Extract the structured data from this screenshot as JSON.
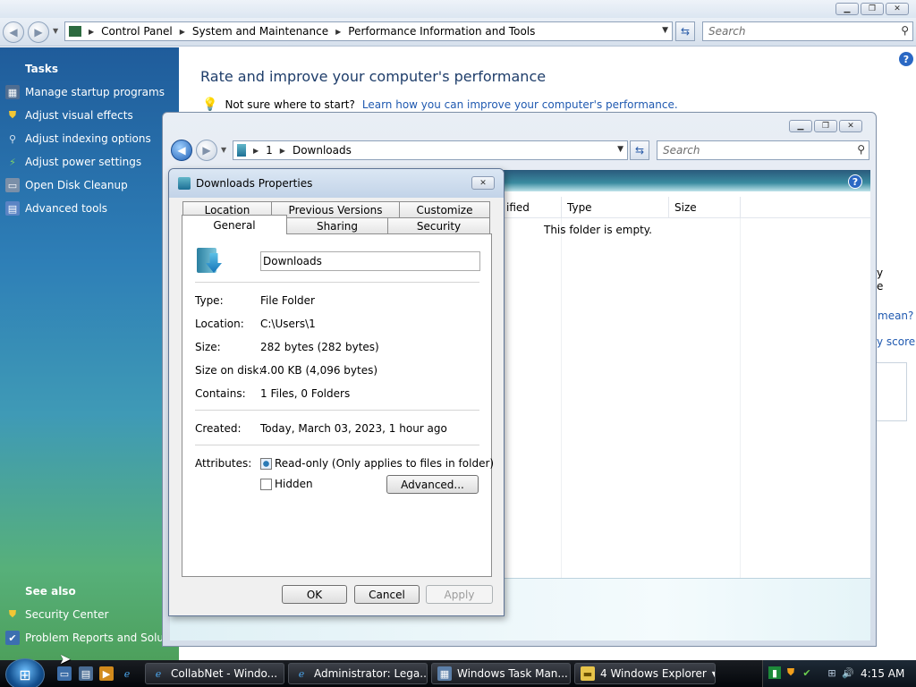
{
  "control_panel": {
    "breadcrumb": [
      "Control Panel",
      "System and Maintenance",
      "Performance Information and Tools"
    ],
    "search_placeholder": "Search",
    "sidebar": {
      "tasks_heading": "Tasks",
      "tasks": [
        {
          "label": "Manage startup programs",
          "icon": "startup-icon"
        },
        {
          "label": "Adjust visual effects",
          "icon": "shield-icon"
        },
        {
          "label": "Adjust indexing options",
          "icon": "indexing-icon"
        },
        {
          "label": "Adjust power settings",
          "icon": "power-icon"
        },
        {
          "label": "Open Disk Cleanup",
          "icon": "disk-cleanup-icon"
        },
        {
          "label": "Advanced tools",
          "icon": "advanced-tools-icon"
        }
      ],
      "see_also_heading": "See also",
      "see_also": [
        {
          "label": "Security Center",
          "icon": "security-center-icon"
        },
        {
          "label": "Problem Reports and Solutio",
          "icon": "problem-reports-icon"
        }
      ]
    },
    "main_title": "Rate and improve your computer's performance",
    "hint_text": "Not sure where to start?",
    "hint_link": "Learn how you can improve your computer's performance.",
    "peek_text_1": "mean?",
    "peek_text_2": "y score",
    "peek_text_3": "y",
    "peek_text_4": "e"
  },
  "explorer": {
    "breadcrumb": [
      "1",
      "Downloads"
    ],
    "search_placeholder": "Search",
    "columns": [
      "ified",
      "Type",
      "Size"
    ],
    "empty_message": "This folder is empty."
  },
  "dialog": {
    "title": "Downloads Properties",
    "tabs_row1": [
      "Location",
      "Previous Versions",
      "Customize"
    ],
    "tabs_row2": [
      "General",
      "Sharing",
      "Security"
    ],
    "selected_tab": "General",
    "folder_name": "Downloads",
    "properties": [
      {
        "label": "Type:",
        "value": "File Folder"
      },
      {
        "label": "Location:",
        "value": "C:\\Users\\1"
      },
      {
        "label": "Size:",
        "value": "282 bytes (282 bytes)"
      },
      {
        "label": "Size on disk:",
        "value": "4.00 KB (4,096 bytes)"
      },
      {
        "label": "Contains:",
        "value": "1 Files, 0 Folders"
      }
    ],
    "created_label": "Created:",
    "created_value": "Today, March 03, 2023, 1 hour ago",
    "attributes_label": "Attributes:",
    "readonly_label": "Read-only (Only applies to files in folder)",
    "readonly_state": "indeterminate",
    "hidden_label": "Hidden",
    "hidden_checked": false,
    "advanced_button": "Advanced...",
    "ok_button": "OK",
    "cancel_button": "Cancel",
    "apply_button": "Apply"
  },
  "taskbar": {
    "tasks": [
      {
        "label": "CollabNet - Windo...",
        "icon": "ie-icon"
      },
      {
        "label": "Administrator: Lega...",
        "icon": "ie-icon"
      },
      {
        "label": "Windows Task Man...",
        "icon": "task-manager-icon"
      },
      {
        "label": "4 Windows Explorer",
        "icon": "folder-icon"
      }
    ],
    "clock": "4:15 AM"
  }
}
